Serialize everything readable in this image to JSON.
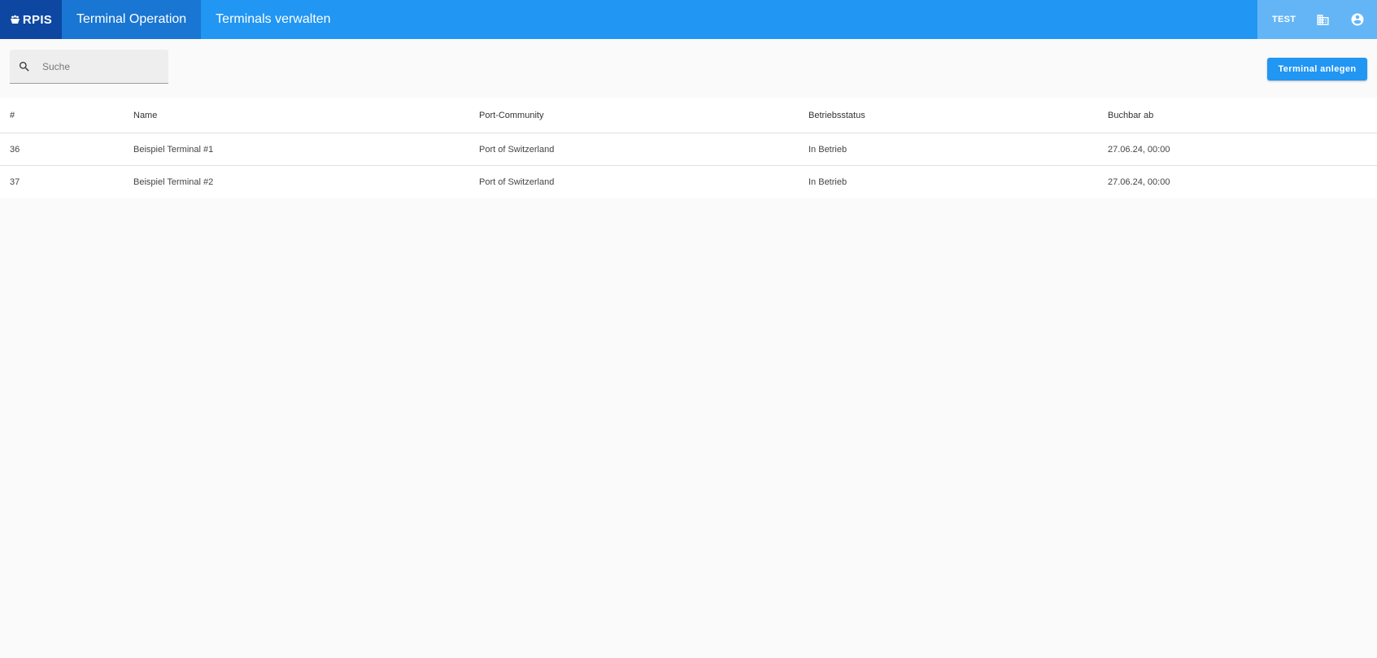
{
  "header": {
    "logo_text": "RPIS",
    "tabs": [
      {
        "label": "Terminal Operation",
        "active": true
      },
      {
        "label": "Terminals verwalten",
        "active": false
      }
    ],
    "environment_label": "TEST",
    "icons": [
      "building-icon",
      "account-circle-icon"
    ]
  },
  "toolbar": {
    "search_placeholder": "Suche",
    "search_value": "",
    "create_button_label": "Terminal anlegen"
  },
  "table": {
    "columns": [
      "#",
      "Name",
      "Port-Community",
      "Betriebsstatus",
      "Buchbar ab"
    ],
    "rows": [
      {
        "id": "36",
        "name": "Beispiel Terminal #1",
        "port_community": "Port of Switzerland",
        "status": "In Betrieb",
        "bookable_from": "27.06.24, 00:00"
      },
      {
        "id": "37",
        "name": "Beispiel Terminal #2",
        "port_community": "Port of Switzerland",
        "status": "In Betrieb",
        "bookable_from": "27.06.24, 00:00"
      }
    ]
  },
  "colors": {
    "primary": "#2196f3",
    "primary_dark": "#1976d2",
    "logo_background": "#0d47a1",
    "topbar_right_background": "#64b5f6"
  }
}
